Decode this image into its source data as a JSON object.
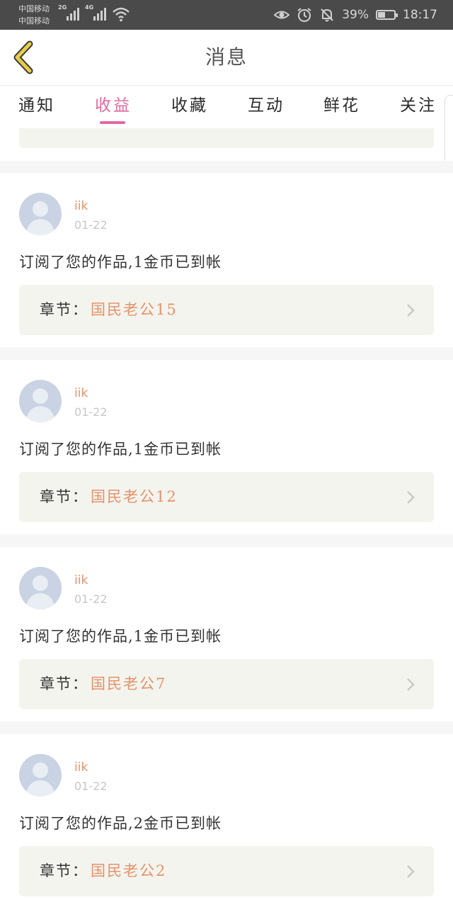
{
  "status_bar": {
    "carrier_1": "中国移动",
    "carrier_2": "中国移动",
    "net_1": "2G",
    "net_2": "4G",
    "battery_percent": "39%",
    "time": "18:17",
    "icons": [
      "eye-icon",
      "alarm-icon",
      "bell-muted-icon",
      "battery-icon"
    ]
  },
  "header": {
    "title": "消息",
    "back_icon": "chevron-left-icon",
    "accent_color": "#e8cc4a"
  },
  "tabs": [
    {
      "label": "通知"
    },
    {
      "label": "收益",
      "active": true
    },
    {
      "label": "收藏"
    },
    {
      "label": "互动"
    },
    {
      "label": "鲜花"
    },
    {
      "label": "关注"
    }
  ],
  "active_tab_color": "#e16aa0",
  "messages": [
    {
      "user": "iik",
      "date": "01-22",
      "text": "订阅了您的作品,1金币已到帐",
      "chapter_label": "章节：",
      "chapter_name": "国民老公15"
    },
    {
      "user": "iik",
      "date": "01-22",
      "text": "订阅了您的作品,1金币已到帐",
      "chapter_label": "章节：",
      "chapter_name": "国民老公12"
    },
    {
      "user": "iik",
      "date": "01-22",
      "text": "订阅了您的作品,1金币已到帐",
      "chapter_label": "章节：",
      "chapter_name": "国民老公7"
    },
    {
      "user": "iik",
      "date": "01-22",
      "text": "订阅了您的作品,2金币已到帐",
      "chapter_label": "章节：",
      "chapter_name": "国民老公2"
    }
  ]
}
